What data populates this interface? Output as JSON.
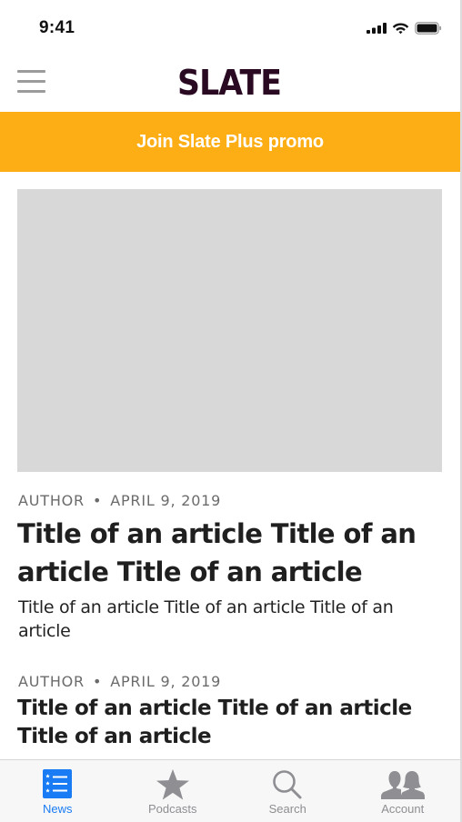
{
  "status_bar": {
    "time": "9:41",
    "icons": [
      "cellular-signal-icon",
      "wifi-icon",
      "battery-icon"
    ]
  },
  "header": {
    "menu_icon": "hamburger-menu-icon",
    "logo_text": "SLATE",
    "brand_color": "#2a0a22"
  },
  "promo": {
    "label": "Join Slate Plus promo",
    "background": "#fdae15"
  },
  "articles": [
    {
      "author": "AUTHOR",
      "separator": "•",
      "date": "APRIL 9, 2019",
      "title": "Title of an article Title of an article Title of an article",
      "description": "Title of an article Title of an article Title of an article",
      "has_image": true
    },
    {
      "author": "AUTHOR",
      "separator": "•",
      "date": "APRIL 9, 2019",
      "title": "Title of an article Title of an article Title of an article"
    }
  ],
  "tab_bar": {
    "active_color": "#1a7cf4",
    "inactive_color": "#8e8e93",
    "tabs": [
      {
        "label": "News",
        "icon": "news-list-icon",
        "active": true
      },
      {
        "label": "Podcasts",
        "icon": "star-icon",
        "active": false
      },
      {
        "label": "Search",
        "icon": "search-icon",
        "active": false
      },
      {
        "label": "Account",
        "icon": "account-people-icon",
        "active": false
      }
    ]
  }
}
